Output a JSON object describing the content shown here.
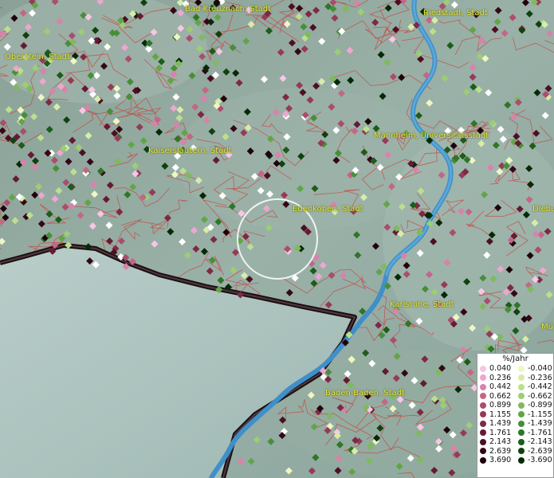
{
  "map": {
    "cities": [
      {
        "name": "Bad Kreuznach, Stadt"
      },
      {
        "name": "Riedstadt, Stadt"
      },
      {
        "name": "Oberstein, Stadt"
      },
      {
        "name": "Kaiserslautern, Stadt"
      },
      {
        "name": "Mannheim, Universitätsstadt"
      },
      {
        "name": "Edenkoben, Stadt"
      },
      {
        "name": "Diebu"
      },
      {
        "name": "Karlsruhe, Stadt"
      },
      {
        "name": "Mü"
      },
      {
        "name": "Baden-Baden, Stadt"
      }
    ]
  },
  "legend": {
    "title": "%/Jahr",
    "positive": [
      {
        "value": "0.040",
        "color": "#f7c6e6"
      },
      {
        "value": "0.236",
        "color": "#eea6cf"
      },
      {
        "value": "0.442",
        "color": "#d982ab"
      },
      {
        "value": "0.662",
        "color": "#c36688"
      },
      {
        "value": "0.899",
        "color": "#ab4d6c"
      },
      {
        "value": "1.155",
        "color": "#963a57"
      },
      {
        "value": "1.439",
        "color": "#7e2944"
      },
      {
        "value": "1.761",
        "color": "#661a33"
      },
      {
        "value": "2.143",
        "color": "#4d0f24"
      },
      {
        "value": "2.639",
        "color": "#350716"
      },
      {
        "value": "3.690",
        "color": "#1f020a"
      }
    ],
    "negative": [
      {
        "value": "-0.040",
        "color": "#eef7c2"
      },
      {
        "value": "-0.236",
        "color": "#d7ecaa"
      },
      {
        "value": "-0.442",
        "color": "#bcdf8e"
      },
      {
        "value": "-0.662",
        "color": "#9dcd74"
      },
      {
        "value": "-0.899",
        "color": "#7fba5c"
      },
      {
        "value": "-1.155",
        "color": "#62a548"
      },
      {
        "value": "-1.439",
        "color": "#478f37"
      },
      {
        "value": "-1.761",
        "color": "#2f7627"
      },
      {
        "value": "-2.143",
        "color": "#1d5c1a"
      },
      {
        "value": "-2.639",
        "color": "#0f420f"
      },
      {
        "value": "-3.690",
        "color": "#052a06"
      }
    ]
  }
}
